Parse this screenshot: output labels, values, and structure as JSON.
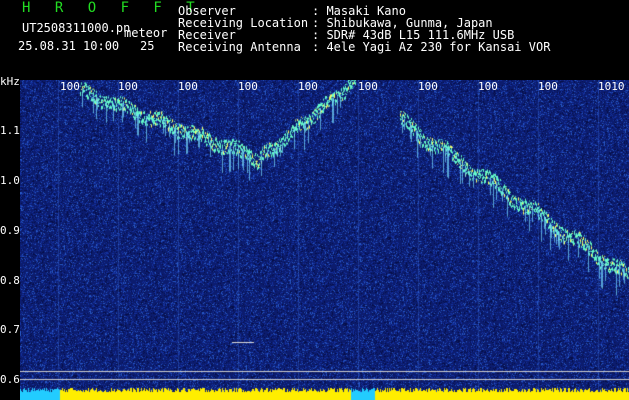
{
  "header": {
    "brand": "H R O F F T",
    "filename_prefix": "UT2508311000.pn",
    "filename_suffix": "meteor",
    "date_time": "25.08.31 10:00",
    "count": "25",
    "fields": [
      {
        "label": "Observer",
        "value": ": Masaki Kano"
      },
      {
        "label": "Receiving Location",
        "value": ": Shibukawa, Gunma, Japan"
      },
      {
        "label": "Receiver",
        "value": ": SDR# 43dB L15 111.6MHz USB"
      },
      {
        "label": "Receiving Antenna",
        "value": ": 4ele Yagi Az 230 for Kansai VOR"
      }
    ]
  },
  "y_axis": {
    "unit": "kHz",
    "ticks": [
      "1.1",
      "1.0",
      "0.9",
      "0.8",
      "0.7",
      "0.6"
    ]
  },
  "x_axis": {
    "ticks": [
      "100",
      "100",
      "100",
      "100",
      "100",
      "100",
      "100",
      "100",
      "100",
      "1010"
    ]
  },
  "colors": {
    "background": "#000000",
    "spectrogram_base": "#0c1c6e",
    "signal_trace": "#66ffcc",
    "signal_peak": "#ffff66",
    "strip_yellow": "#ffee00",
    "strip_cyan": "#22ccff",
    "brand_green": "#22dd22"
  }
}
